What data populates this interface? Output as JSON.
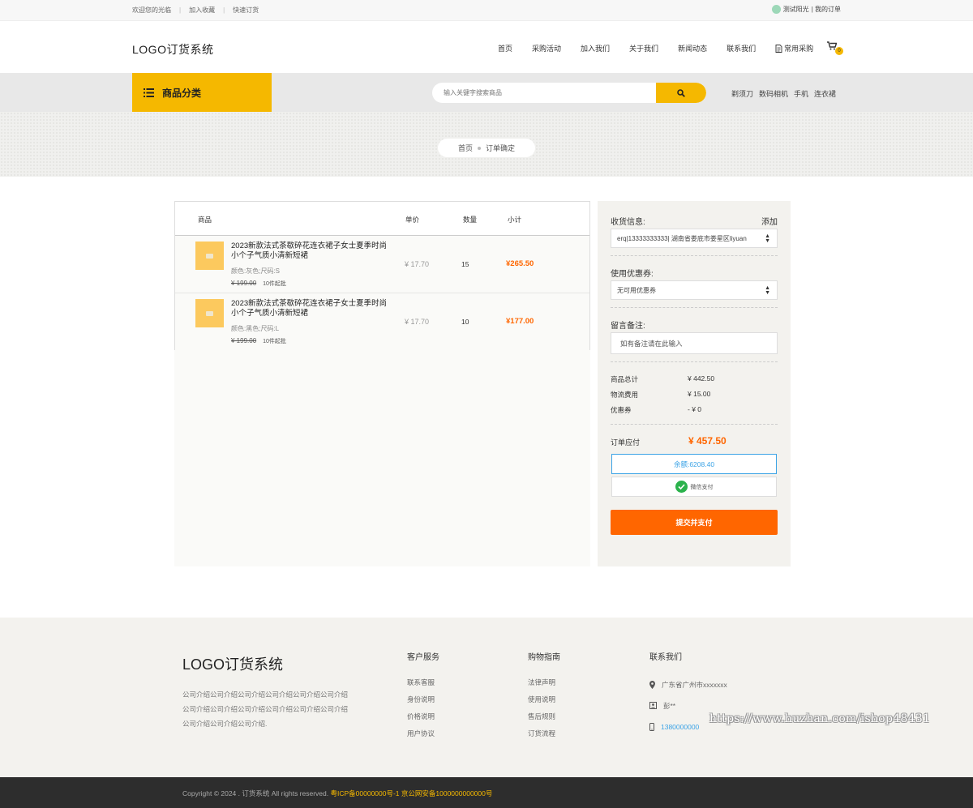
{
  "topbar": {
    "welcome": "欢迎您的光临",
    "favorite": "加入收藏",
    "quick_order": "快速订货",
    "user": "测试阳光",
    "my_orders": "| 我的订单"
  },
  "header": {
    "logo": "LOGO订货系统",
    "nav": [
      "首页",
      "采购活动",
      "加入我们",
      "关于我们",
      "新闻动态",
      "联系我们"
    ],
    "fav_purchase": "常用采购",
    "cart_count": "0"
  },
  "catbar": {
    "category_label": "商品分类",
    "search_placeholder": "输入关键字搜索商品",
    "hotwords": [
      "剃须刀",
      "数码相机",
      "手机",
      "连衣裙"
    ]
  },
  "breadcrumb": {
    "home": "首页",
    "current": "订单确定"
  },
  "order_table": {
    "headers": {
      "product": "商品",
      "unit_price": "单价",
      "quantity": "数量",
      "subtotal": "小计"
    },
    "rows": [
      {
        "name": "2023新款法式茶歇碎花连衣裙子女士夏季时尚小个子气质小清新短裙",
        "attrs": "颜色:灰色;尺码:S",
        "original_price": "¥ 199.00",
        "min_qty": "10件起批",
        "unit_price": "¥ 17.70",
        "quantity": "15",
        "subtotal": "¥265.50"
      },
      {
        "name": "2023新款法式茶歇碎花连衣裙子女士夏季时尚小个子气质小清新短裙",
        "attrs": "颜色:黑色;尺码:L",
        "original_price": "¥ 199.00",
        "min_qty": "10件起批",
        "unit_price": "¥ 17.70",
        "quantity": "10",
        "subtotal": "¥177.00"
      }
    ]
  },
  "side": {
    "shipping_label": "收货信息:",
    "add_label": "添加",
    "address_value": "erq|13333333333| 湖南省娄底市娄星区liyuan",
    "coupon_label": "使用优惠券:",
    "coupon_value": "无可用优惠券",
    "note_label": "留言备注:",
    "note_placeholder": "如有备注请在此输入",
    "goods_total_label": "商品总计",
    "goods_total_value": "¥  442.50",
    "shipping_fee_label": "物流费用",
    "shipping_fee_value": "¥  15.00",
    "coupon_discount_label": "优惠券",
    "coupon_discount_value": "- ¥ 0",
    "payable_label": "订单应付",
    "payable_value": "¥  457.50",
    "balance_button": "余额:6208.40",
    "wechat_button": "微信支付",
    "submit_button": "提交并支付"
  },
  "footer": {
    "logo": "LOGO订货系统",
    "description": "公司介绍公司介绍公司介绍公司介绍公司介绍公司介绍公司介绍公司介绍公司介绍公司介绍公司介绍公司介绍公司介绍公司介绍公司介绍.",
    "columns": [
      {
        "title": "客户服务",
        "items": [
          "联系客服",
          "身份说明",
          "价格说明",
          "用户协议"
        ]
      },
      {
        "title": "购物指南",
        "items": [
          "法律声明",
          "使用说明",
          "售后规则",
          "订货流程"
        ]
      }
    ],
    "contact_title": "联系我们",
    "address": "广东省广州市xxxxxxx",
    "person": "彭**",
    "phone": "1380000000",
    "watermark": "https://www.huzhan.com/ishop48431",
    "copyright": "Copyright © 2024 . 订货系统 All rights reserved.",
    "icp": "粤ICP备00000000号-1 京公网安备1000000000000号"
  },
  "colors": {
    "accent_yellow": "#f5b800",
    "price_orange": "#ff6600",
    "link_blue": "#3ba3e6"
  }
}
